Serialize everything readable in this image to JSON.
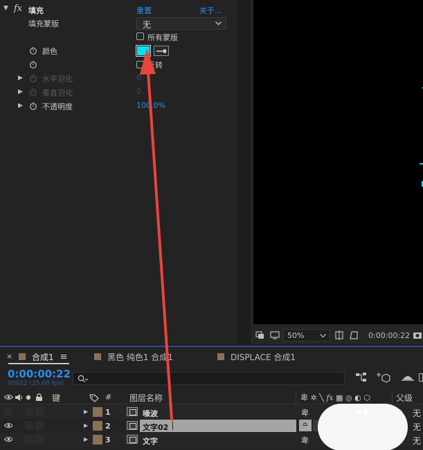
{
  "effect_controls": {
    "effect_name": "填充",
    "fx_glyph": "fx",
    "reset_label": "重置",
    "about_label": "关于...",
    "props": {
      "fill_mask_label": "填充蒙版",
      "fill_mask_value": "无",
      "all_masks_label": "所有蒙版",
      "color_label": "颜色",
      "color_value": "#00e5f5",
      "invert_label": "反转",
      "h_feather_label": "水平羽化",
      "h_feather_value": "0.",
      "v_feather_label": "垂直羽化",
      "v_feather_value": "0.",
      "opacity_label": "不透明度",
      "opacity_value": "100.0%"
    }
  },
  "viewer": {
    "zoom_value": "50%",
    "timecode": "0:00:00:22"
  },
  "timeline": {
    "tabs": [
      {
        "label": "合成1",
        "active": true
      },
      {
        "label": "黑色 纯色1 合成1",
        "active": false
      },
      {
        "label": "DISPLACE 合成1",
        "active": false
      }
    ],
    "timecode": "0:00:00:22",
    "frame_info": "00022 (25.00 fps)",
    "search_placeholder": "",
    "columns": {
      "key": "键",
      "hash": "#",
      "layer_name": "图层名称",
      "parent": "父级"
    },
    "layers": [
      {
        "num": "1",
        "name": "噪波",
        "parent": "无",
        "selected": false
      },
      {
        "num": "2",
        "name": "文字02",
        "parent": "无",
        "selected": true
      },
      {
        "num": "3",
        "name": "文字",
        "parent": "无",
        "selected": false
      }
    ]
  },
  "annotation": {
    "arrow_color": "#e8453c"
  }
}
